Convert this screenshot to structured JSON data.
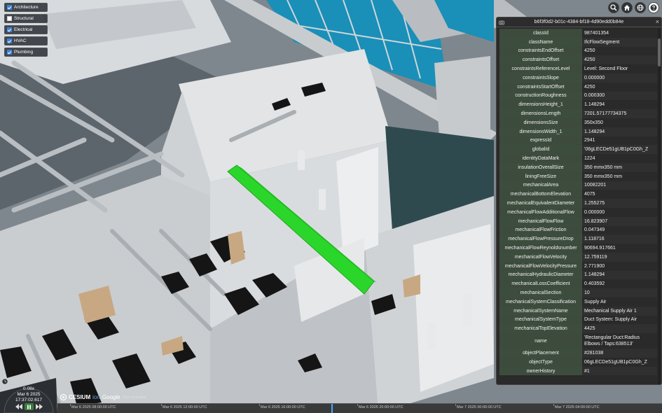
{
  "layers": [
    {
      "label": "Architecture",
      "checked": true
    },
    {
      "label": "Structural",
      "checked": false
    },
    {
      "label": "Electrical",
      "checked": true
    },
    {
      "label": "HVAC",
      "checked": true
    },
    {
      "label": "Plumbing",
      "checked": true
    }
  ],
  "toolbar": {
    "icons": [
      "search-icon",
      "home-icon",
      "globe-icon",
      "help-icon"
    ]
  },
  "infobox": {
    "title": "b6f3f0d2-b01c-4384-bf18-4d90edd0b84e",
    "close": "×",
    "rows": [
      [
        "classId",
        "987401354"
      ],
      [
        "className",
        "IfcFlowSegment"
      ],
      [
        "constraintsEndOffset",
        "4250"
      ],
      [
        "constraintsOffset",
        "4250"
      ],
      [
        "constraintsReferenceLevel",
        "Level: Second Floor"
      ],
      [
        "constraintsSlope",
        "0.000000"
      ],
      [
        "constraintsStartOffset",
        "4250"
      ],
      [
        "constructionRoughness",
        "0.000300"
      ],
      [
        "dimensionsHeight_1",
        "1.148294"
      ],
      [
        "dimensionsLength",
        "7201.57177734375"
      ],
      [
        "dimensionsSize",
        "350x350"
      ],
      [
        "dimensionsWidth_1",
        "1.148294"
      ],
      [
        "expressId",
        "2941"
      ],
      [
        "globalId",
        "'06gLECDe51gUB1pC0Gh_Z"
      ],
      [
        "identityDataMark",
        "1224"
      ],
      [
        "insulationOverallSize",
        "350 mmx350 mm"
      ],
      [
        "liningFreeSize",
        "350 mmx350 mm"
      ],
      [
        "mechanicalArea",
        "10082201"
      ],
      [
        "mechanicalBottomElevation",
        "4075"
      ],
      [
        "mechanicalEquivalentDiameter",
        "1.255275"
      ],
      [
        "mechanicalFlowAdditionalFlow",
        "0.000000"
      ],
      [
        "mechanicalFlowFlow",
        "16.823907"
      ],
      [
        "mechanicalFlowFriction",
        "0.047349"
      ],
      [
        "mechanicalFlowPressureDrop",
        "1.118716"
      ],
      [
        "mechanicalFlowReynoldsnumber",
        "90694.917661"
      ],
      [
        "mechanicalFlowVelocity",
        "12.759119"
      ],
      [
        "mechanicalFlowVelocityPressure",
        "2.771900"
      ],
      [
        "mechanicalHydraulicDiameter",
        "1.148294"
      ],
      [
        "mechanicalLossCoefficient",
        "0.403592"
      ],
      [
        "mechanicalSection",
        "10"
      ],
      [
        "mechanicalSystemClassification",
        "Supply Air"
      ],
      [
        "mechanicalSystemName",
        "Mechanical Supply Air 1"
      ],
      [
        "mechanicalSystemType",
        "Duct System: Supply Air"
      ],
      [
        "mechanicalTopElevation",
        "4425"
      ],
      [
        "name",
        "'Rectangular Duct:Radius Elbows / Taps:638513'"
      ],
      [
        "objectPlacement",
        "#281038"
      ],
      [
        "objectType",
        "06gLECDe51gUB1pC0Gh_Z"
      ],
      [
        "ownerHistory",
        "#1"
      ]
    ]
  },
  "animation": {
    "speed": "0.08x",
    "date": "Mar 6 2025",
    "time": "17:37:02.617"
  },
  "credits": {
    "cesium": "CESIUM",
    "ion": "ion",
    "google": "Google",
    "data": "Data attribution"
  },
  "timeline": {
    "labels": [
      "Mar 6 2025 08:00:00 UTC",
      "Mar 6 2025 12:00:00 UTC",
      "Mar 6 2025 16:00:00 UTC",
      "Mar 6 2025 20:00:00 UTC",
      "Mar 7 2025 00:00:00 UTC",
      "Mar 7 2025 04:00:00 UTC"
    ]
  },
  "colors": {
    "highlight": "#2bd62b",
    "window": "#1a8fb8",
    "panel": "#262626"
  }
}
